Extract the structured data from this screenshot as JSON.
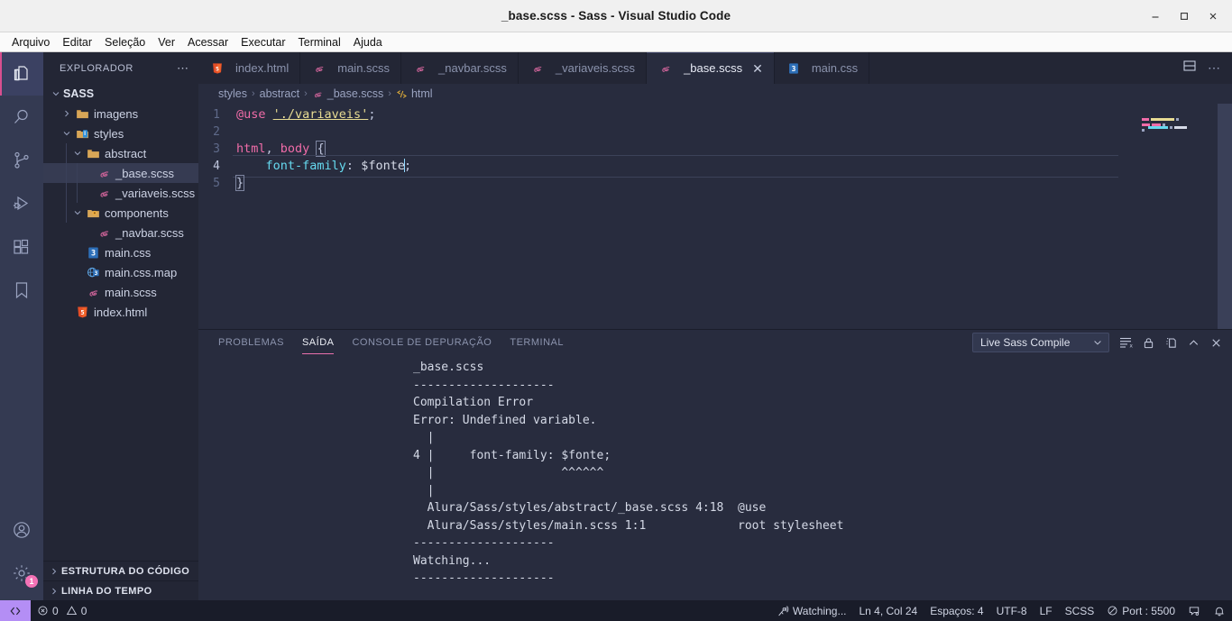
{
  "window": {
    "title": "_base.scss - Sass - Visual Studio Code",
    "minimize_label": "−",
    "maximize_label": "❐",
    "close_label": "✕"
  },
  "menubar": {
    "items": [
      {
        "label": "Arquivo"
      },
      {
        "label": "Editar"
      },
      {
        "label": "Seleção"
      },
      {
        "label": "Ver"
      },
      {
        "label": "Acessar"
      },
      {
        "label": "Executar"
      },
      {
        "label": "Terminal"
      },
      {
        "label": "Ajuda"
      }
    ]
  },
  "activitybar": {
    "items": [
      {
        "name": "explorer-icon",
        "active": true
      },
      {
        "name": "search-icon",
        "active": false
      },
      {
        "name": "source-control-icon",
        "active": false
      },
      {
        "name": "run-debug-icon",
        "active": false
      },
      {
        "name": "extensions-icon",
        "active": false
      },
      {
        "name": "bookmark-icon",
        "active": false
      }
    ],
    "bottom": [
      {
        "name": "account-icon"
      },
      {
        "name": "settings-gear-icon",
        "badge": "1"
      }
    ]
  },
  "sidebar": {
    "header": "EXPLORADOR",
    "more_actions": "⋯",
    "root": "SASS",
    "tree": [
      {
        "label": "SASS",
        "depth": 0,
        "type": "root",
        "expanded": true,
        "icon": "none"
      },
      {
        "label": "imagens",
        "depth": 1,
        "type": "folder",
        "expanded": false,
        "icon": "folder-icon"
      },
      {
        "label": "styles",
        "depth": 1,
        "type": "folder",
        "expanded": true,
        "icon": "folder-styles-icon"
      },
      {
        "label": "abstract",
        "depth": 2,
        "type": "folder",
        "expanded": true,
        "icon": "folder-icon"
      },
      {
        "label": "_base.scss",
        "depth": 3,
        "type": "file",
        "icon": "sass-icon",
        "selected": true
      },
      {
        "label": "_variaveis.scss",
        "depth": 3,
        "type": "file",
        "icon": "sass-icon"
      },
      {
        "label": "components",
        "depth": 2,
        "type": "folder",
        "expanded": true,
        "icon": "folder-components-icon"
      },
      {
        "label": "_navbar.scss",
        "depth": 3,
        "type": "file",
        "icon": "sass-icon"
      },
      {
        "label": "main.css",
        "depth": 2,
        "type": "file",
        "icon": "css-icon"
      },
      {
        "label": "main.css.map",
        "depth": 2,
        "type": "file",
        "icon": "cssmap-icon"
      },
      {
        "label": "main.scss",
        "depth": 2,
        "type": "file",
        "icon": "sass-icon"
      },
      {
        "label": "index.html",
        "depth": 1,
        "type": "file",
        "icon": "html-icon"
      }
    ],
    "sections": [
      {
        "label": "ESTRUTURA DO CÓDIGO"
      },
      {
        "label": "LINHA DO TEMPO"
      }
    ]
  },
  "editor": {
    "tabs": [
      {
        "label": "index.html",
        "icon": "html-icon",
        "active": false,
        "closable": false
      },
      {
        "label": "main.scss",
        "icon": "sass-icon",
        "active": false,
        "closable": false
      },
      {
        "label": "_navbar.scss",
        "icon": "sass-icon",
        "active": false,
        "closable": false
      },
      {
        "label": "_variaveis.scss",
        "icon": "sass-icon",
        "active": false,
        "closable": false
      },
      {
        "label": "_base.scss",
        "icon": "sass-icon",
        "active": true,
        "closable": true,
        "close_label": "✕"
      },
      {
        "label": "main.css",
        "icon": "css-icon",
        "active": false,
        "closable": false
      }
    ],
    "actions": [
      {
        "name": "split-editor-icon"
      },
      {
        "name": "more-actions-icon",
        "label": "⋯"
      }
    ],
    "breadcrumb": [
      {
        "label": "styles",
        "icon": "none"
      },
      {
        "label": "abstract",
        "icon": "none"
      },
      {
        "label": "_base.scss",
        "icon": "sass-icon"
      },
      {
        "label": "html",
        "icon": "symbol-icon"
      }
    ],
    "breadcrumb_separator": "›",
    "lines": [
      {
        "num": "1",
        "current": false
      },
      {
        "num": "2",
        "current": false
      },
      {
        "num": "3",
        "current": false
      },
      {
        "num": "4",
        "current": true
      },
      {
        "num": "5",
        "current": false
      }
    ],
    "code": {
      "l1_at": "@use",
      "l1_str": "'./variaveis'",
      "l1_end": ";",
      "l3_tag1": "html",
      "l3_comma": ", ",
      "l3_tag2": "body",
      "l3_brace": "{",
      "l4_indent": "    ",
      "l4_prop": "font-family",
      "l4_colon": ": ",
      "l4_var": "$fonte",
      "l4_semi": ";",
      "l5_brace": "}"
    }
  },
  "panel": {
    "tabs": [
      {
        "label": "PROBLEMAS",
        "active": false
      },
      {
        "label": "SAÍDA",
        "active": true
      },
      {
        "label": "CONSOLE DE DEPURAÇÃO",
        "active": false
      },
      {
        "label": "TERMINAL",
        "active": false
      }
    ],
    "channel": "Live Sass Compile",
    "channel_chevron": "⌄",
    "actions": [
      {
        "name": "clear-output-icon"
      },
      {
        "name": "lock-icon"
      },
      {
        "name": "open-editor-icon"
      },
      {
        "name": "maximize-panel-icon",
        "label": "⌃"
      },
      {
        "name": "close-panel-icon",
        "label": "✕"
      }
    ],
    "output": "_base.scss\n--------------------\nCompilation Error\nError: Undefined variable.\n  |\n4 |     font-family: $fonte;\n  |                  ^^^^^^\n  |\n  Alura/Sass/styles/abstract/_base.scss 4:18  @use\n  Alura/Sass/styles/main.scss 1:1             root stylesheet\n--------------------\nWatching...\n--------------------"
  },
  "statusbar": {
    "remote_label": "≶",
    "errors": "0",
    "warnings": "0",
    "right_items": [
      {
        "name": "watching-status",
        "label": "Watching...",
        "icon": "broadcast-icon"
      },
      {
        "name": "cursor-position",
        "label": "Ln 4, Col 24"
      },
      {
        "name": "indentation",
        "label": "Espaços: 4"
      },
      {
        "name": "encoding",
        "label": "UTF-8"
      },
      {
        "name": "eol",
        "label": "LF"
      },
      {
        "name": "language-mode",
        "label": "SCSS"
      },
      {
        "name": "live-port",
        "label": "Port : 5500",
        "icon": "no-entry-icon"
      },
      {
        "name": "feedback-icon",
        "label": ""
      },
      {
        "name": "notifications-bell-icon",
        "label": ""
      }
    ]
  },
  "colors": {
    "accent_pink": "#e96fad",
    "sass_pink": "#cf649a",
    "html_orange": "#e44d26",
    "css_blue": "#2d6fb8",
    "folder_tan": "#d8a657",
    "activity_bg": "#343a52",
    "sidebar_bg": "#232635",
    "editor_bg": "#282c3e",
    "status_bg": "#191c29",
    "remote_purple": "#b48ef5"
  }
}
